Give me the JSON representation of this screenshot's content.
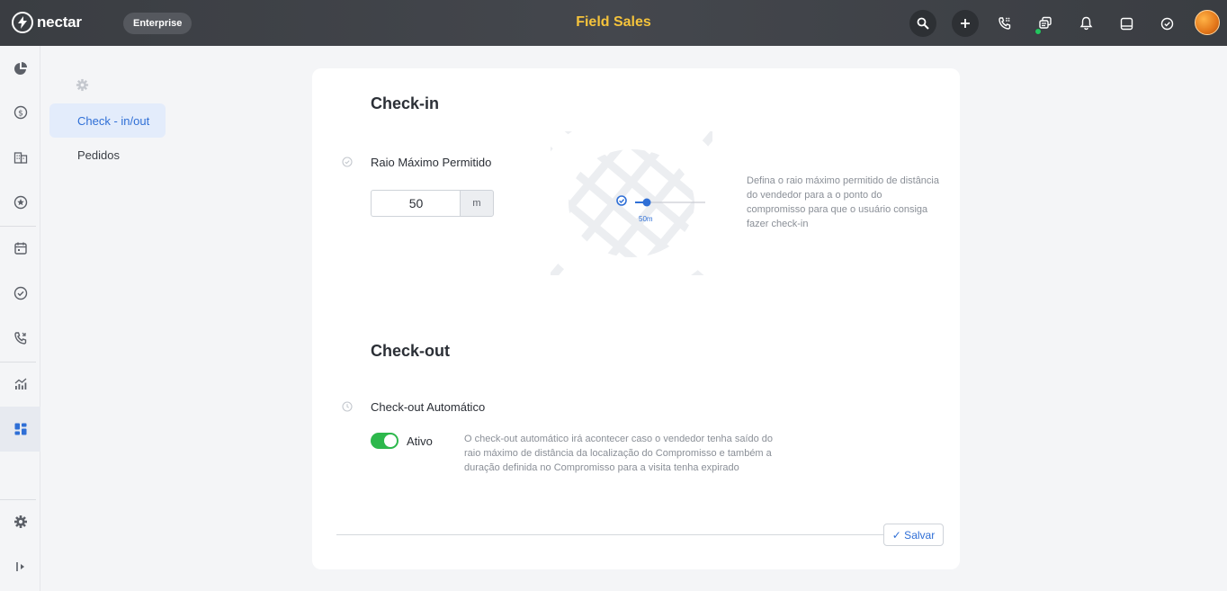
{
  "app": {
    "brand": "nectar",
    "plan": "Enterprise",
    "title": "Field Sales"
  },
  "colors": {
    "accent": "#2f6fd6",
    "title_yellow": "#f5c33b",
    "toggle_on": "#2db84c",
    "online": "#22c55e"
  },
  "topbar": {
    "icons": [
      "search-icon",
      "plus-icon",
      "phone-grid-icon",
      "chat-stack-icon",
      "bell-icon",
      "inbox-icon",
      "check-circle-icon"
    ]
  },
  "rail": {
    "icons": [
      "pie-chart-icon",
      "dollar-icon",
      "building-icon",
      "star-icon",
      "calendar-icon",
      "check-circle-icon",
      "phone-icon",
      "analytics-icon",
      "dashboard-icon",
      "settings-icon",
      "collapse-icon"
    ],
    "active": "dashboard-icon"
  },
  "subnav": {
    "items": [
      {
        "label": "Check - in/out",
        "active": true
      },
      {
        "label": "Pedidos",
        "active": false
      }
    ]
  },
  "checkin": {
    "title": "Check-in",
    "field_label": "Raio Máximo Permitido",
    "radius_value": "50",
    "unit": "m",
    "radius_label": "50m",
    "help": "Defina o raio máximo permitido de distância do vendedor para a o ponto do compromisso para que o usuário consiga fazer check-in"
  },
  "checkout": {
    "title": "Check-out",
    "field_label": "Check-out Automático",
    "toggle_on": true,
    "toggle_label": "Ativo",
    "help": "O check-out automático irá acontecer caso o vendedor tenha saído do raio máximo de distância da localização do Compromisso e também a duração definida no Compromisso para a visita tenha expirado"
  },
  "actions": {
    "save_label": "✓ Salvar"
  }
}
